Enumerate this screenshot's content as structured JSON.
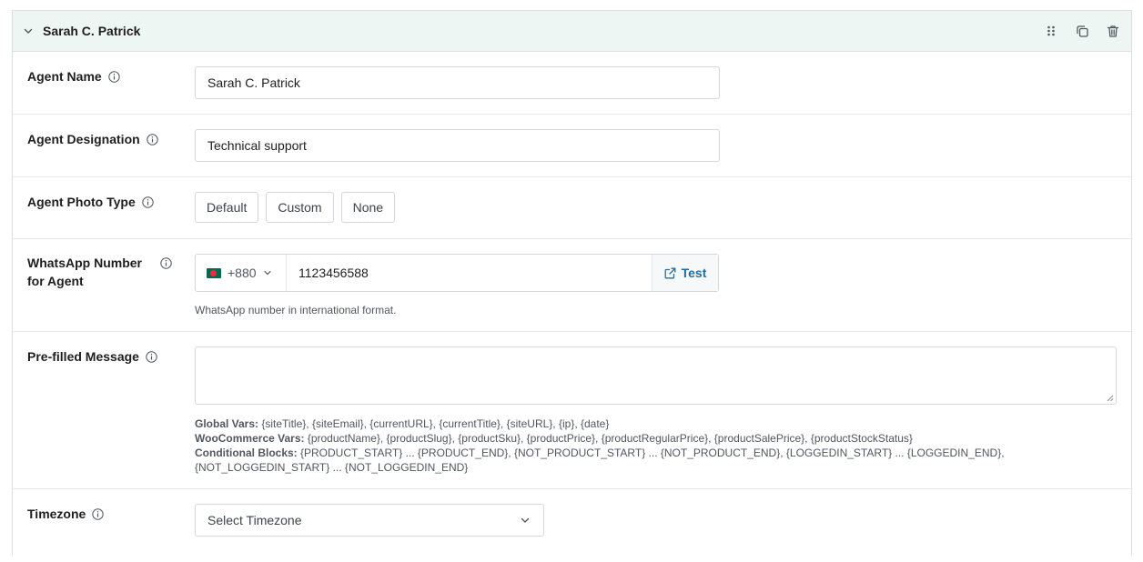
{
  "header": {
    "title": "Sarah C. Patrick"
  },
  "fields": {
    "agent_name": {
      "label": "Agent Name",
      "value": "Sarah C. Patrick"
    },
    "agent_designation": {
      "label": "Agent Designation",
      "value": "Technical support"
    },
    "photo_type": {
      "label": "Agent Photo Type",
      "options": [
        "Default",
        "Custom",
        "None"
      ]
    },
    "whatsapp": {
      "label_line1": "WhatsApp Number",
      "label_line2": "for Agent",
      "country_code": "+880",
      "number": "1123456588",
      "test_label": "Test",
      "help": "WhatsApp number in international format."
    },
    "prefilled": {
      "label": "Pre-filled Message",
      "value": "",
      "global_label": "Global Vars:",
      "global_vars": " {siteTitle}, {siteEmail}, {currentURL}, {currentTitle}, {siteURL}, {ip}, {date}",
      "woo_label": "WooCommerce Vars:",
      "woo_vars": " {productName}, {productSlug}, {productSku}, {productPrice}, {productRegularPrice}, {productSalePrice}, {productStockStatus}",
      "cond_label": "Conditional Blocks:",
      "cond_vars": " {PRODUCT_START} ... {PRODUCT_END}, {NOT_PRODUCT_START} ... {NOT_PRODUCT_END}, {LOGGEDIN_START} ... {LOGGEDIN_END}, {NOT_LOGGEDIN_START} ... {NOT_LOGGEDIN_END}"
    },
    "timezone": {
      "label": "Timezone",
      "placeholder": "Select Timezone"
    }
  },
  "colors": {
    "header_bg": "#eef6f4",
    "accent": "#1f6ea8",
    "flag_green": "#006a4e",
    "flag_red": "#f42a41"
  }
}
